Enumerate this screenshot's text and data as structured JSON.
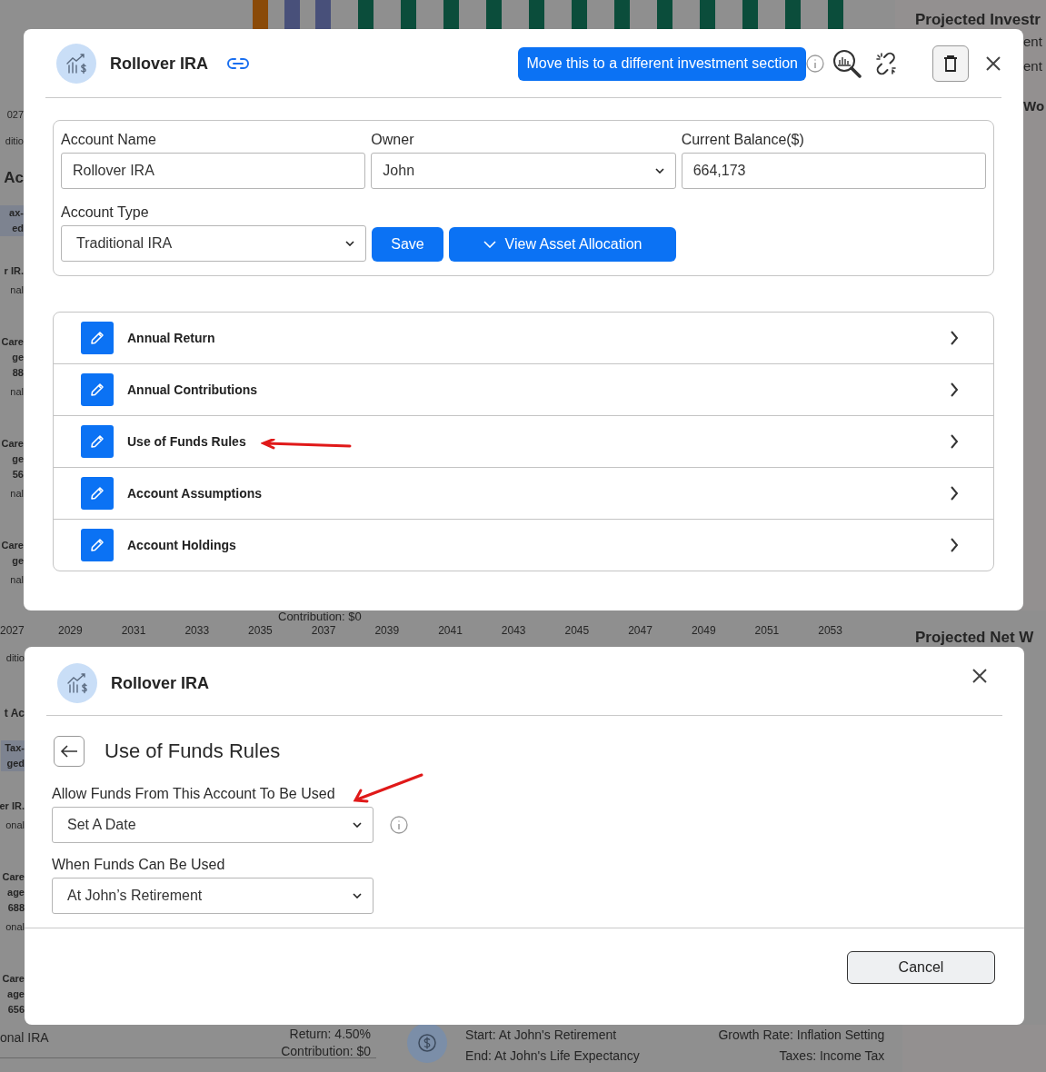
{
  "backdrop": {
    "top": {
      "heading": "Projected Investr",
      "right_lines": [
        "ent",
        "ent"
      ],
      "right_heading": "Wo",
      "left": [
        {
          "kind": "axis",
          "lines": [
            "027"
          ]
        },
        {
          "kind": "sub",
          "lines": [
            "ditio"
          ]
        },
        {
          "kind": "heading",
          "lines": [
            "Ac"
          ]
        },
        {
          "kind": "tag",
          "lines": [
            "ax-",
            "ed"
          ]
        },
        {
          "kind": "name",
          "lines": [
            "r IR."
          ]
        },
        {
          "kind": "sub",
          "lines": [
            "nal"
          ]
        },
        {
          "kind": "name",
          "lines": [
            "Care",
            "ge",
            "88"
          ]
        },
        {
          "kind": "sub",
          "lines": [
            "nal"
          ]
        },
        {
          "kind": "name",
          "lines": [
            "Care",
            "ge",
            "56"
          ]
        },
        {
          "kind": "sub",
          "lines": [
            "nal"
          ]
        },
        {
          "kind": "name",
          "lines": [
            "Care",
            "ge"
          ]
        },
        {
          "kind": "sub",
          "lines": [
            "nal"
          ]
        }
      ],
      "contribution": "Contribution: $0",
      "years": [
        "2027",
        "2029",
        "2031",
        "2033",
        "2035",
        "2037",
        "2039",
        "2041",
        "2043",
        "2045",
        "2047",
        "2049",
        "2051",
        "2053"
      ],
      "net_heading": "Projected Net W"
    },
    "middle": {
      "left": [
        {
          "kind": "sub",
          "lines": [
            "ditio"
          ]
        },
        {
          "kind": "heading",
          "lines": [
            "t Ac"
          ]
        },
        {
          "kind": "tag",
          "lines": [
            "Tax-",
            "ged"
          ]
        },
        {
          "kind": "name",
          "lines": [
            "er IR."
          ]
        },
        {
          "kind": "sub",
          "lines": [
            "onal"
          ]
        },
        {
          "kind": "name",
          "lines": [
            "Care",
            "age",
            "688"
          ]
        },
        {
          "kind": "sub",
          "lines": [
            "onal"
          ]
        },
        {
          "kind": "name",
          "lines": [
            "Care",
            "age",
            "656"
          ]
        }
      ]
    },
    "bottom": {
      "left": "onal IRA",
      "return": "Return: 4.50%",
      "contribution": "Contribution: $0",
      "start": "Start: At John's Retirement",
      "end": "End: At John's Life Expectancy",
      "growth": "Growth Rate: Inflation Setting",
      "taxes": "Taxes: Income Tax"
    }
  },
  "account_modal": {
    "title": "Rollover IRA",
    "move_button": "Move this to a different investment section",
    "fields": [
      {
        "kind": "input",
        "label": "Account Name",
        "value": "Rollover IRA"
      },
      {
        "kind": "select",
        "label": "Owner",
        "value": "John"
      },
      {
        "kind": "input",
        "label": "Current Balance($)",
        "value": "664,173"
      },
      {
        "kind": "select",
        "label": "Account Type",
        "value": "Traditional IRA"
      }
    ],
    "save_button": "Save",
    "allocation_button": "View Asset Allocation",
    "sections": [
      {
        "label": "Annual Return",
        "annotated": false
      },
      {
        "label": "Annual Contributions",
        "annotated": false
      },
      {
        "label": "Use of Funds Rules",
        "annotated": true
      },
      {
        "label": "Account Assumptions",
        "annotated": false
      },
      {
        "label": "Account Holdings",
        "annotated": false
      }
    ]
  },
  "rules_modal": {
    "title": "Rollover IRA",
    "page_title": "Use of Funds Rules",
    "fields": [
      {
        "label": "Allow Funds From This Account To Be Used",
        "value": "Set A Date",
        "info": true,
        "annotated": true
      },
      {
        "label": "When Funds Can Be Used",
        "value": "At John’s Retirement",
        "info": false,
        "annotated": false
      }
    ],
    "cancel_button": "Cancel"
  }
}
